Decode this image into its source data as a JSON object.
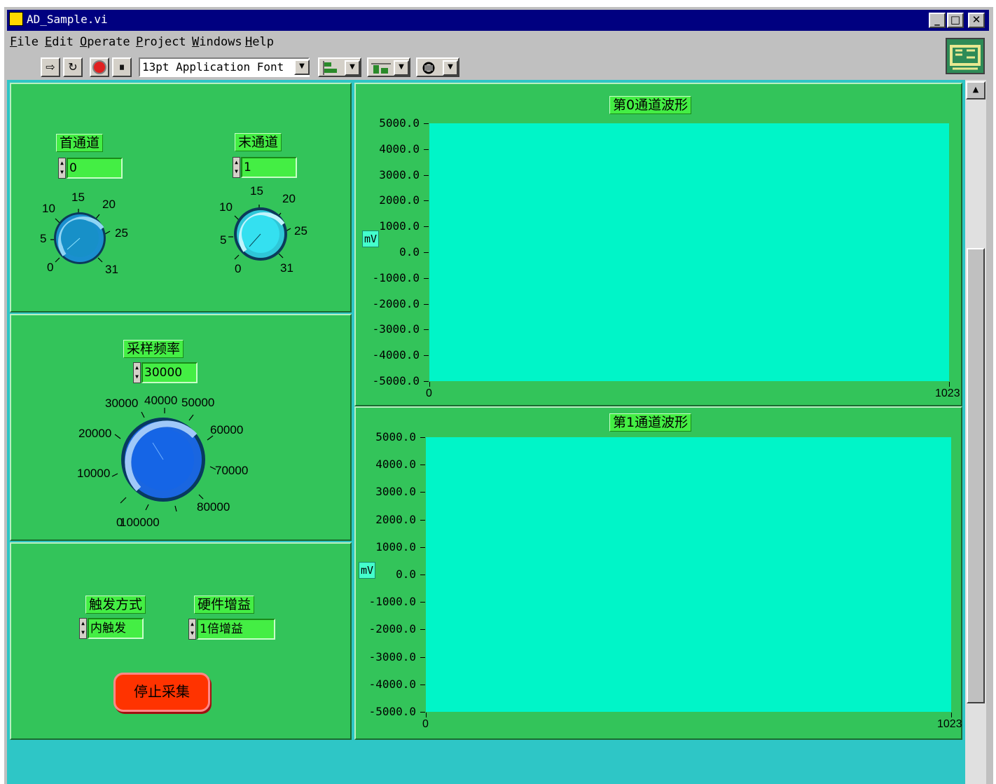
{
  "window": {
    "title": "AD_Sample.vi",
    "minimize": "_",
    "maximize": "□",
    "close": "✕"
  },
  "menu": {
    "items": [
      {
        "label": "File"
      },
      {
        "label": "Edit"
      },
      {
        "label": "Operate"
      },
      {
        "label": "Project"
      },
      {
        "label": "Windows"
      },
      {
        "label": "Help"
      }
    ]
  },
  "toolbar": {
    "font": "13pt Application Font"
  },
  "channels": {
    "first": {
      "label": "首通道",
      "value": "0",
      "ticks": [
        "0",
        "5",
        "10",
        "15",
        "20",
        "25",
        "31"
      ],
      "knob_value": 0
    },
    "last": {
      "label": "末通道",
      "value": "1",
      "ticks": [
        "0",
        "5",
        "10",
        "15",
        "20",
        "25",
        "31"
      ],
      "knob_value": 1
    }
  },
  "sampling": {
    "label": "采样频率",
    "value": "30000",
    "ticks": [
      "0",
      "10000",
      "20000",
      "30000",
      "40000",
      "50000",
      "60000",
      "70000",
      "80000",
      "100000"
    ],
    "knob_value": 30000
  },
  "trigger": {
    "label": "触发方式",
    "value": "内触发"
  },
  "gain": {
    "label": "硬件增益",
    "value": "1倍增益"
  },
  "stop_button": {
    "label": "停止采集"
  },
  "chart_data": [
    {
      "type": "line",
      "title": "第0通道波形",
      "ylabel": "mV",
      "xlim": [
        0,
        1023
      ],
      "ylim": [
        -5000,
        5000
      ],
      "x_ticks": [
        "0",
        "1023"
      ],
      "y_ticks": [
        "5000.0",
        "4000.0",
        "3000.0",
        "2000.0",
        "1000.0",
        "0.0",
        "-1000.0",
        "-2000.0",
        "-3000.0",
        "-4000.0",
        "-5000.0"
      ],
      "series": [],
      "background": "#00f5c8"
    },
    {
      "type": "line",
      "title": "第1通道波形",
      "ylabel": "mV",
      "xlim": [
        0,
        1023
      ],
      "ylim": [
        -5000,
        5000
      ],
      "x_ticks": [
        "0",
        "1023"
      ],
      "y_ticks": [
        "5000.0",
        "4000.0",
        "3000.0",
        "2000.0",
        "1000.0",
        "0.0",
        "-1000.0",
        "-2000.0",
        "-3000.0",
        "-4000.0",
        "-5000.0"
      ],
      "series": [],
      "background": "#00f5c8"
    }
  ]
}
